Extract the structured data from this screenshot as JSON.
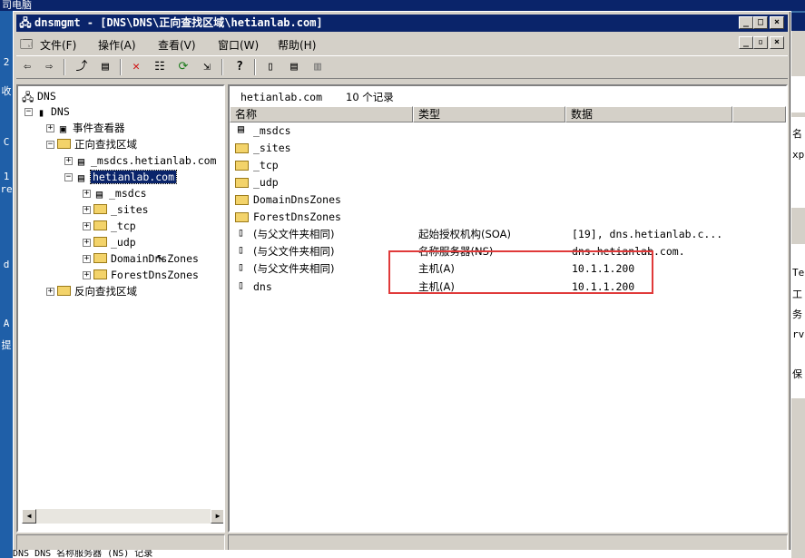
{
  "desktop": {
    "top_text": "司电脑",
    "left_glyphs": [
      "2",
      "收",
      "C",
      "1",
      "re",
      "d",
      "A",
      "提"
    ],
    "bottom_text": "DNS DNS 名称服务器 (NS) 记录",
    "right_texts": [
      "名",
      "xp",
      "Te",
      "工",
      "务",
      "rv",
      "保"
    ]
  },
  "window": {
    "title": "dnsmgmt - [DNS\\DNS\\正向查找区域\\hetianlab.com]",
    "controls": {
      "minimize": "_",
      "maximize": "□",
      "close": "×"
    },
    "child_controls": {
      "minimize": "_",
      "restore": "▫",
      "close": "×"
    }
  },
  "menu": [
    {
      "label": "文件(F)"
    },
    {
      "label": "操作(A)"
    },
    {
      "label": "查看(V)"
    },
    {
      "label": "窗口(W)"
    },
    {
      "label": "帮助(H)"
    }
  ],
  "toolbar": {
    "icons": [
      "back-icon",
      "forward-icon",
      "up-icon",
      "show-tree-icon",
      "delete-icon",
      "properties-icon",
      "refresh-icon",
      "export-icon",
      "help-icon",
      "server-icon",
      "zone-icon",
      "domain-icon"
    ],
    "glyphs": [
      "⇦",
      "⇨",
      "⤴",
      "▤",
      "✕",
      "☷",
      "⟳",
      "⇲",
      "?",
      "▯",
      "▤",
      "▥"
    ]
  },
  "tree": {
    "root": "DNS",
    "server": "DNS",
    "event_viewer": "事件查看器",
    "forward_zones": "正向查找区域",
    "msdcs_zone": "_msdcs.hetianlab.com",
    "selected_zone": "hetianlab.com",
    "children": [
      "_msdcs",
      "_sites",
      "_tcp",
      "_udp",
      "DomainDnsZones",
      "ForestDnsZones"
    ],
    "reverse_zones": "反向查找区域"
  },
  "list": {
    "zone_name": "hetianlab.com",
    "record_count": "10 个记录",
    "columns": {
      "name": "名称",
      "type": "类型",
      "data": "数据"
    },
    "rows": [
      {
        "name": "_msdcs",
        "type": "",
        "data": "",
        "kind": "special-folder"
      },
      {
        "name": "_sites",
        "type": "",
        "data": "",
        "kind": "folder"
      },
      {
        "name": "_tcp",
        "type": "",
        "data": "",
        "kind": "folder"
      },
      {
        "name": "_udp",
        "type": "",
        "data": "",
        "kind": "folder"
      },
      {
        "name": "DomainDnsZones",
        "type": "",
        "data": "",
        "kind": "folder"
      },
      {
        "name": "ForestDnsZones",
        "type": "",
        "data": "",
        "kind": "folder"
      },
      {
        "name": "(与父文件夹相同)",
        "type": "起始授权机构(SOA)",
        "data": "[19], dns.hetianlab.c...",
        "kind": "record"
      },
      {
        "name": "(与父文件夹相同)",
        "type": "名称服务器(NS)",
        "data": "dns.hetianlab.com.",
        "kind": "record"
      },
      {
        "name": "(与父文件夹相同)",
        "type": "主机(A)",
        "data": "10.1.1.200",
        "kind": "record"
      },
      {
        "name": "dns",
        "type": "主机(A)",
        "data": "10.1.1.200",
        "kind": "record"
      }
    ]
  },
  "colors": {
    "titlebar": "#0a246a",
    "highlight_box": "#e03a3a",
    "window_face": "#d4d0c8"
  }
}
